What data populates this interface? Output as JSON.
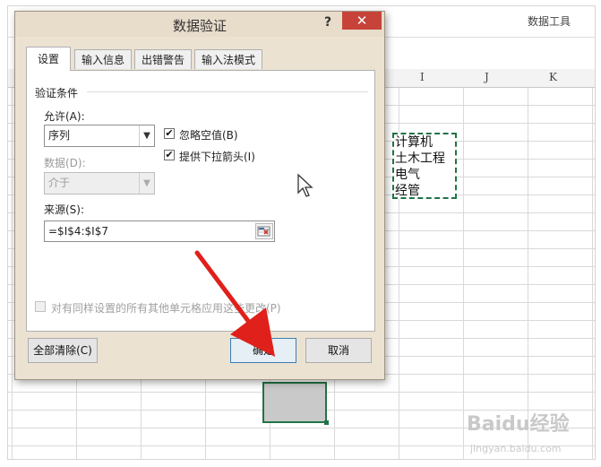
{
  "sheet": {
    "ribbon_tab": "数据工具",
    "columns": [
      "I",
      "J",
      "K"
    ],
    "list_items": [
      "计算机",
      "土木工程",
      "电气",
      "经管"
    ]
  },
  "dialog": {
    "title": "数据验证",
    "help": "?",
    "close": "✕",
    "tabs": [
      "设置",
      "输入信息",
      "出错警告",
      "输入法模式"
    ],
    "section_title": "验证条件",
    "allow_label": "允许(A):",
    "allow_value": "序列",
    "data_label": "数据(D):",
    "data_value": "介于",
    "ignore_blank_label": "忽略空值(B)",
    "ignore_blank_checked": true,
    "dropdown_label": "提供下拉箭头(I)",
    "dropdown_checked": true,
    "source_label": "来源(S):",
    "source_value": "=$I$4:$I$7",
    "apply_all_label": "对有同样设置的所有其他单元格应用这些更改(P)",
    "apply_all_checked": false,
    "clear_all_button": "全部清除(C)",
    "ok_button": "确定",
    "cancel_button": "取消"
  },
  "watermark": {
    "brand": "Baidu经验",
    "url": "jingyan.baidu.com"
  },
  "colors": {
    "selection_green": "#217346",
    "close_red": "#c7433a",
    "arrow_red": "#e0201b",
    "dialog_bg": "#ece2d2"
  },
  "icons": {
    "check": "✔",
    "dropdown": "chevron-down",
    "collapse_ref": "range-select-icon"
  }
}
